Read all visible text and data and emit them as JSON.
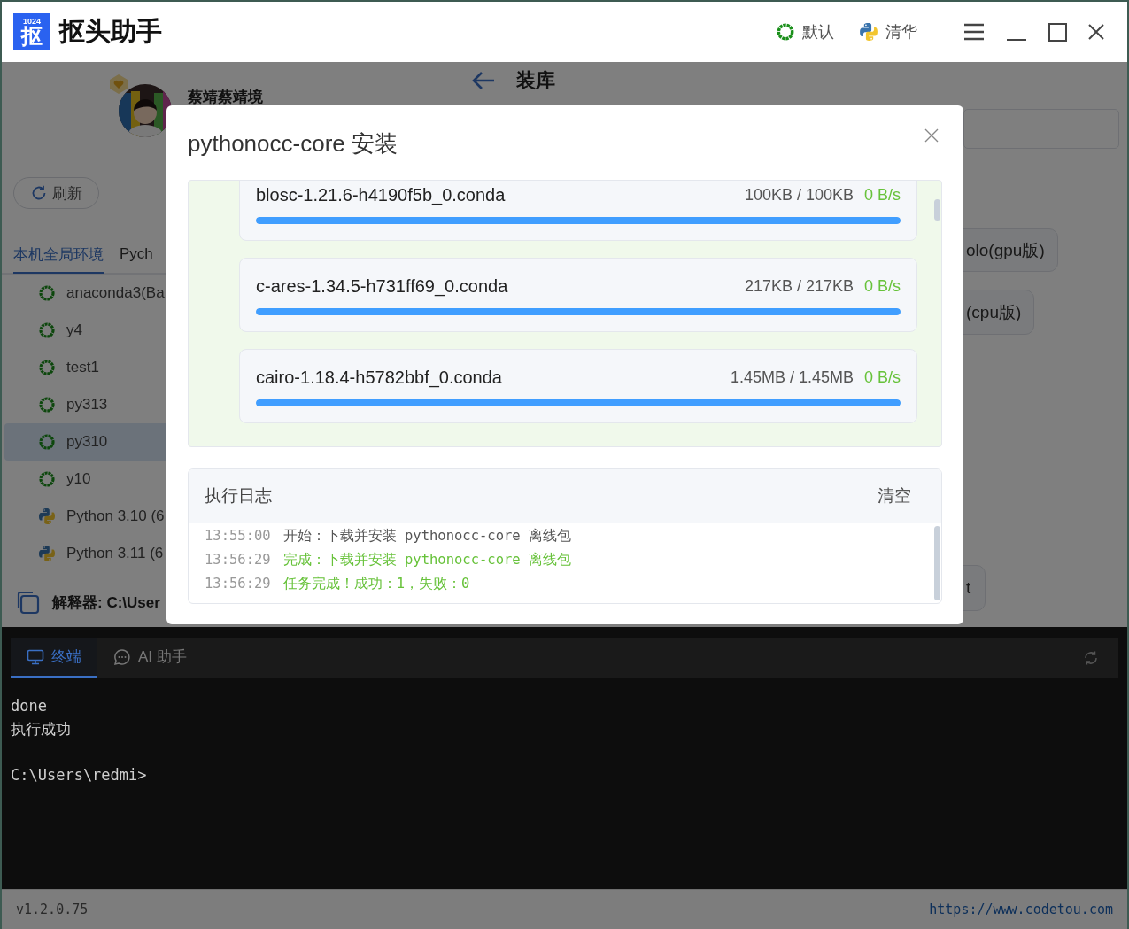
{
  "app": {
    "logo_text": "1024",
    "logo_glyph": "抠",
    "title": "抠头助手"
  },
  "header_actions": [
    {
      "kind": "conda",
      "label": "默认"
    },
    {
      "kind": "python",
      "label": "清华"
    }
  ],
  "profile": {
    "name": "蔡靖蔡靖境"
  },
  "refresh_button": "刷新",
  "env_tabs": [
    {
      "label": "本机全局环境",
      "selected": true
    },
    {
      "label": "Pych",
      "selected": false
    }
  ],
  "environments": [
    {
      "kind": "conda",
      "name": "anaconda3(Ba",
      "selected": false
    },
    {
      "kind": "conda",
      "name": "y4",
      "selected": false
    },
    {
      "kind": "conda",
      "name": "test1",
      "selected": false
    },
    {
      "kind": "conda",
      "name": "py313",
      "selected": false
    },
    {
      "kind": "conda",
      "name": "py310",
      "selected": true
    },
    {
      "kind": "conda",
      "name": "y10",
      "selected": false
    },
    {
      "kind": "python",
      "name": "Python 3.10 (6",
      "selected": false
    },
    {
      "kind": "python",
      "name": "Python 3.11 (6",
      "selected": false
    }
  ],
  "interpreter": "解释器: C:\\User",
  "page": {
    "title": "装库"
  },
  "options": [
    "olo(gpu版)",
    "(cpu版)",
    "t"
  ],
  "dialog": {
    "title": "pythonocc-core 安装",
    "downloads": [
      {
        "file": "blosc-1.21.6-h4190f5b_0.conda",
        "size": "100KB / 100KB",
        "speed": "0 B/s",
        "level": 1
      },
      {
        "file": "c-ares-1.34.5-h731ff69_0.conda",
        "size": "217KB / 217KB",
        "speed": "0 B/s",
        "level": 1
      },
      {
        "file": "cairo-1.18.4-h5782bbf_0.conda",
        "size": "1.45MB / 1.45MB",
        "speed": "0 B/s",
        "level": 1
      }
    ],
    "log": {
      "title": "执行日志",
      "clear_button": "清空",
      "entries": [
        {
          "time": "13:55:00",
          "message": "开始：下载并安装 pythonocc-core 离线包",
          "success": false
        },
        {
          "time": "13:56:29",
          "message": "完成：下载并安装 pythonocc-core 离线包",
          "success": true
        },
        {
          "time": "13:56:29",
          "message": "任务完成！成功：1，失败：0",
          "success": true
        }
      ]
    }
  },
  "terminal": {
    "tabs": [
      {
        "kind": "terminal",
        "label": "终端",
        "selected": true
      },
      {
        "kind": "chat",
        "label": "AI 助手",
        "selected": false
      }
    ],
    "blocks": [
      [
        "done",
        "执行成功"
      ],
      [
        "C:\\Users\\redmi>"
      ]
    ]
  },
  "footer": {
    "version": "v1.2.0.75",
    "link": "https://www.codetou.com"
  }
}
